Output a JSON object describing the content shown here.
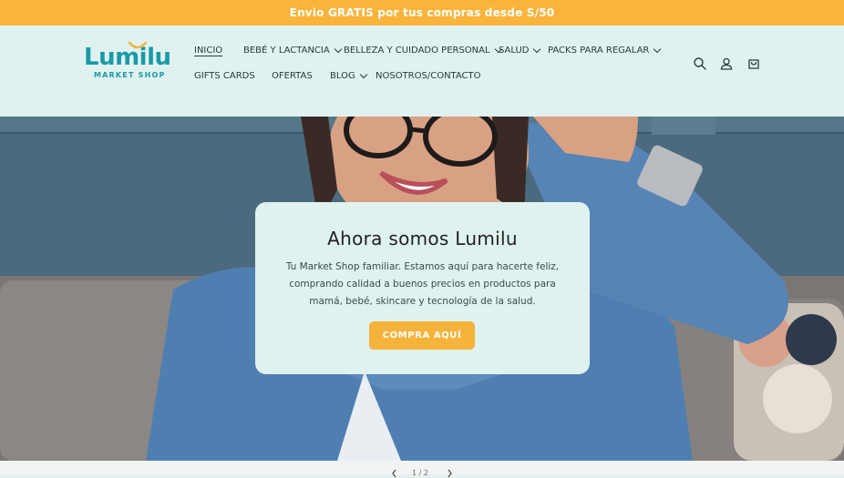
{
  "announcement": "Envio GRATIS por tus compras desde S/50",
  "logo": {
    "name": "Lumilu",
    "sub": "MARKET SHOP"
  },
  "nav": {
    "row1": [
      {
        "label": "INICIO",
        "dropdown": false,
        "active": true
      },
      {
        "label": "BEBÉ Y LACTANCIA",
        "dropdown": true
      },
      {
        "label": "BELLEZA Y CUIDADO PERSONAL",
        "dropdown": true
      },
      {
        "label": "SALUD",
        "dropdown": true
      },
      {
        "label": "PACKS PARA REGALAR",
        "dropdown": true
      }
    ],
    "row2": [
      {
        "label": "GIFTS CARDS",
        "dropdown": false
      },
      {
        "label": "OFERTAS",
        "dropdown": false
      },
      {
        "label": "BLOG",
        "dropdown": true
      },
      {
        "label": "NOSOTROS/CONTACTO",
        "dropdown": false
      }
    ]
  },
  "icons": [
    "search-icon",
    "account-icon",
    "cart-icon"
  ],
  "hero": {
    "title": "Ahora somos Lumilu",
    "text": "Tu Market Shop familiar. Estamos aquí para hacerte feliz, comprando calidad a buenos precios en productos para mamá, bebé, skincare y tecnología de la salud.",
    "button": "COMPRA AQUÍ"
  },
  "slider": {
    "counter": "1 / 2"
  },
  "colors": {
    "accent": "#fab43b",
    "brand": "#1a9aa8",
    "header_bg": "#dff2ef"
  }
}
